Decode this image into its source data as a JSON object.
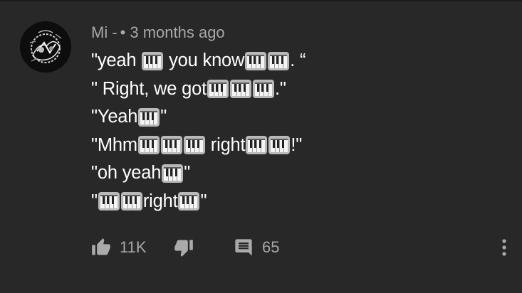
{
  "comment": {
    "author": "Mi -",
    "separator": "•",
    "time": "3 months ago",
    "avatar_icon": "avatar-image",
    "lines": [
      [
        {
          "t": "\"yeah "
        },
        {
          "p": 1
        },
        {
          "t": " you know"
        },
        {
          "p": 1
        },
        {
          "p": 1
        },
        {
          "t": ". “"
        }
      ],
      [
        {
          "t": "\" Right, we got"
        },
        {
          "p": 1
        },
        {
          "p": 1
        },
        {
          "p": 1
        },
        {
          "t": ".\""
        }
      ],
      [
        {
          "t": "\"Yeah"
        },
        {
          "p": 1
        },
        {
          "t": "\""
        }
      ],
      [
        {
          "t": "\"Mhm"
        },
        {
          "p": 1
        },
        {
          "p": 1
        },
        {
          "p": 1
        },
        {
          "t": " right"
        },
        {
          "p": 1
        },
        {
          "p": 1
        },
        {
          "t": "!\""
        }
      ],
      [
        {
          "t": "\"oh yeah"
        },
        {
          "p": 1
        },
        {
          "t": "\""
        }
      ],
      [
        {
          "t": "\""
        },
        {
          "p": 1
        },
        {
          "p": 1
        },
        {
          "t": "right"
        },
        {
          "p": 1
        },
        {
          "t": "\""
        }
      ]
    ],
    "emoji_icon": "piano-keyboard-emoji"
  },
  "actions": {
    "like_count": "11K",
    "reply_count": "65",
    "like_icon": "thumbs-up-icon",
    "dislike_icon": "thumbs-down-icon",
    "reply_icon": "comment-icon",
    "more_icon": "more-vertical-icon"
  },
  "colors": {
    "background": "#282828",
    "text": "#ffffff",
    "secondary": "#a8a8a8"
  }
}
